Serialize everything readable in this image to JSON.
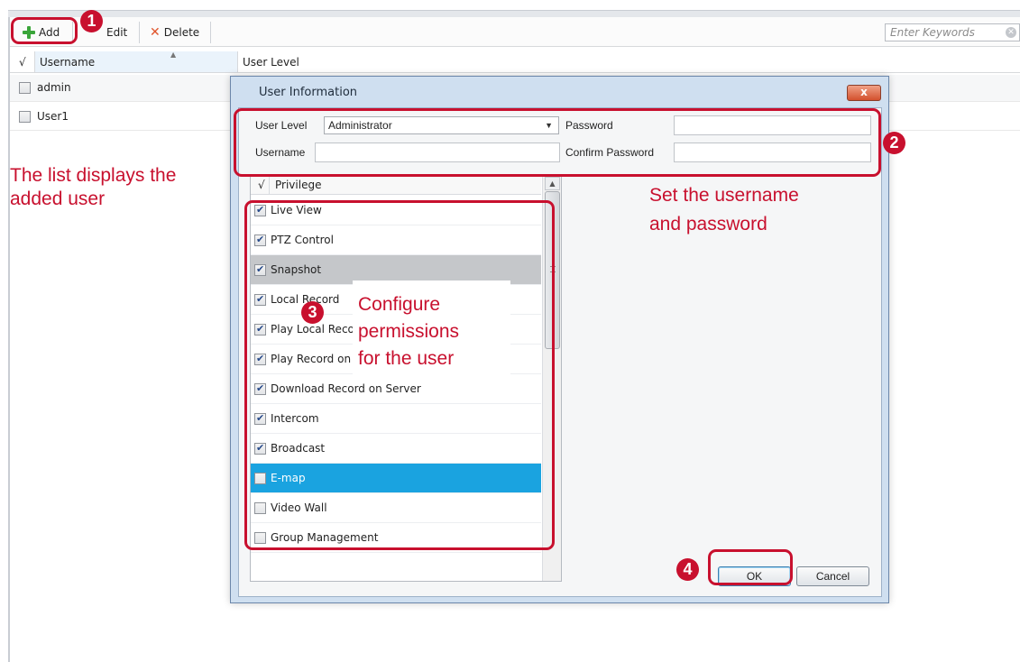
{
  "toolbar": {
    "add_label": "Add",
    "edit_label": "Edit",
    "delete_label": "Delete",
    "search_placeholder": "Enter Keywords"
  },
  "user_list": {
    "columns": [
      "√",
      "Username",
      "User Level"
    ],
    "rows": [
      {
        "username": "admin",
        "level": ""
      },
      {
        "username": "User1",
        "level": ""
      }
    ]
  },
  "dialog": {
    "title": "User Information",
    "close_label": "x",
    "user_level_label": "User Level",
    "user_level_value": "Administrator",
    "username_label": "Username",
    "username_value": "",
    "password_label": "Password",
    "confirm_password_label": "Confirm Password",
    "privilege_header": {
      "check": "√",
      "label": "Privilege"
    },
    "privileges": [
      {
        "label": "Live View",
        "checked": true
      },
      {
        "label": "PTZ Control",
        "checked": true
      },
      {
        "label": "Snapshot",
        "checked": true,
        "state": "hover"
      },
      {
        "label": "Local Record",
        "checked": true
      },
      {
        "label": "Play Local Record",
        "checked": true
      },
      {
        "label": "Play Record on Server",
        "checked": true
      },
      {
        "label": "Download Record on Server",
        "checked": true
      },
      {
        "label": "Intercom",
        "checked": true
      },
      {
        "label": "Broadcast",
        "checked": true
      },
      {
        "label": "E-map",
        "checked": false,
        "state": "selected"
      },
      {
        "label": "Video Wall",
        "checked": false
      },
      {
        "label": "Group Management",
        "checked": false
      }
    ],
    "ok_label": "OK",
    "cancel_label": "Cancel"
  },
  "annotations": {
    "marker_1": "1",
    "marker_2": "2",
    "marker_3": "3",
    "marker_4": "4",
    "list_note_line1": "The list displays the",
    "list_note_line2": "added user",
    "credentials_note_line1": "Set the username",
    "credentials_note_line2": "and password",
    "permissions_note_line1": "Configure",
    "permissions_note_line2": "permissions",
    "permissions_note_line3": "for the user",
    "color": "#c8102e"
  },
  "colors": {
    "selected_row": "#1aa3e0",
    "hover_row": "#c5c7ca",
    "dialog_frame": "#cfdff0"
  }
}
